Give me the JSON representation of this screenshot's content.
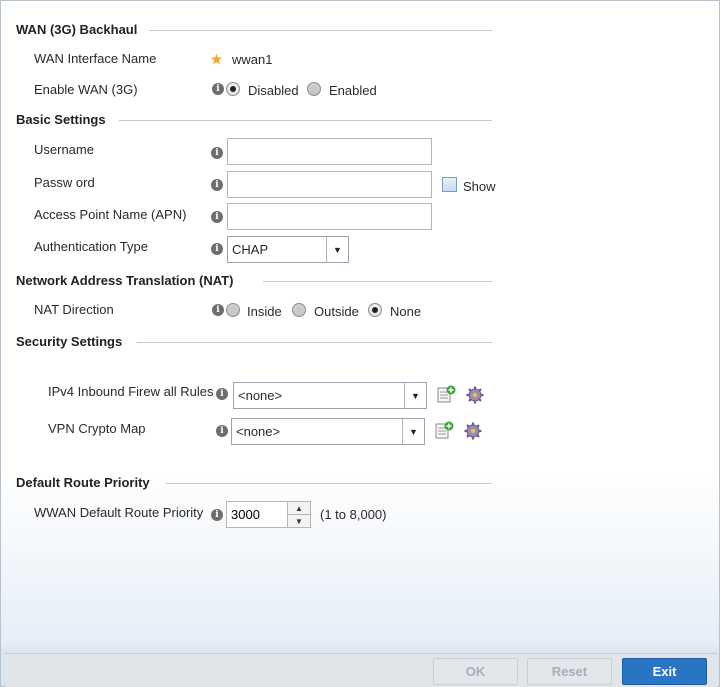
{
  "sections": {
    "wan": "WAN (3G) Backhaul",
    "basic": "Basic Settings",
    "nat": "Network Address Translation (NAT)",
    "security": "Security Settings",
    "route": "Default Route Priority"
  },
  "wan": {
    "interface_label": "WAN Interface Name",
    "interface_value": "wwan1",
    "enable_label": "Enable WAN (3G)",
    "options": [
      "Disabled",
      "Enabled"
    ],
    "selected": "Disabled"
  },
  "basic": {
    "username_label": "Username",
    "username_value": "",
    "password_label": "Passw ord",
    "password_value": "",
    "show_label": "Show",
    "apn_label": "Access Point Name (APN)",
    "apn_value": "",
    "auth_label": "Authentication Type",
    "auth_value": "CHAP"
  },
  "nat": {
    "direction_label": "NAT Direction",
    "options": [
      "Inside",
      "Outside",
      "None"
    ],
    "selected": "None"
  },
  "security": {
    "firewall_label": "IPv4 Inbound Firew all Rules",
    "firewall_value": "<none>",
    "vpn_label": "VPN Crypto Map",
    "vpn_value": "<none>"
  },
  "route": {
    "priority_label": "WWAN Default Route Priority",
    "priority_value": "3000",
    "range_hint": "(1 to 8,000)"
  },
  "footer": {
    "ok_label": "OK",
    "reset_label": "Reset",
    "exit_label": "Exit"
  },
  "colors": {
    "accent": "#2a74c4",
    "required_star": "#f5a623"
  },
  "icons": [
    "required-star-icon",
    "info-icon",
    "dropdown-arrow-icon",
    "create-new-icon",
    "edit-settings-icon",
    "spin-up-icon",
    "spin-down-icon"
  ]
}
